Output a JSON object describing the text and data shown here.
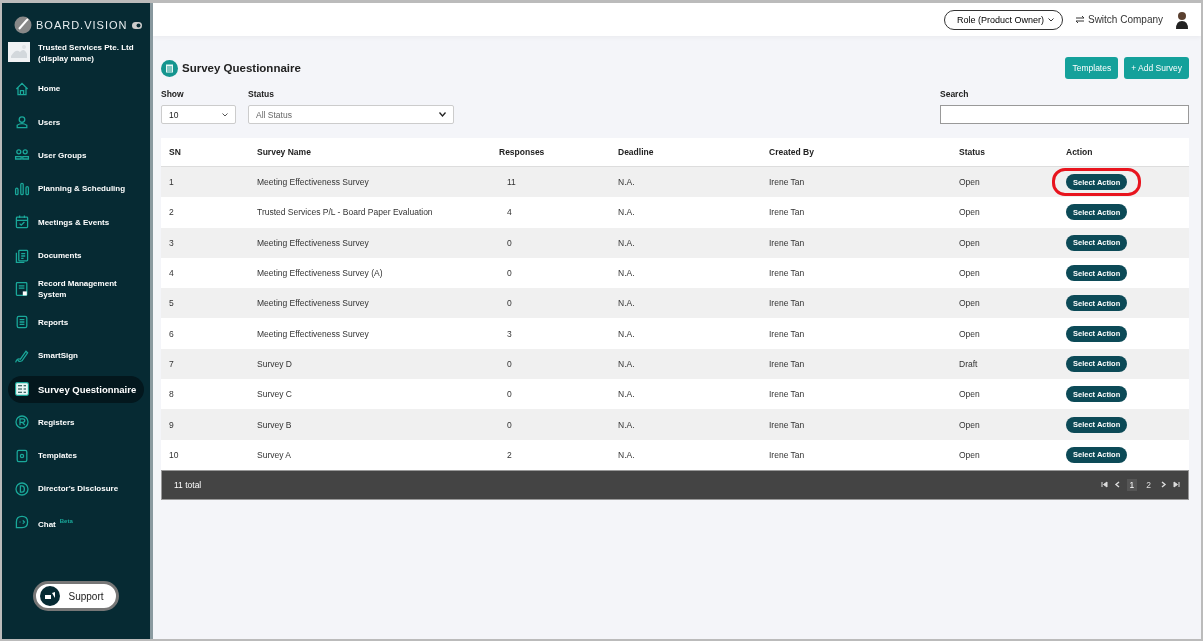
{
  "sidebar": {
    "brand": "BOARD.VISION",
    "company": "Trusted Services Pte. Ltd (display name)",
    "items": [
      {
        "label": "Home",
        "selected": false
      },
      {
        "label": "Users",
        "selected": false
      },
      {
        "label": "User Groups",
        "selected": false
      },
      {
        "label": "Planning & Scheduling",
        "selected": false
      },
      {
        "label": "Meetings & Events",
        "selected": false
      },
      {
        "label": "Documents",
        "selected": false
      },
      {
        "label": "Record Management System",
        "selected": false
      },
      {
        "label": "Reports",
        "selected": false
      },
      {
        "label": "SmartSign",
        "selected": false
      },
      {
        "label": "Survey Questionnaire",
        "selected": true
      },
      {
        "label": "Registers",
        "selected": false
      },
      {
        "label": "Templates",
        "selected": false
      },
      {
        "label": "Director's Disclosure",
        "selected": false
      },
      {
        "label": "Chat",
        "selected": false,
        "badge": "Beta"
      }
    ],
    "support": "Support"
  },
  "topbar": {
    "role": "Role (Product Owner)",
    "switch_company": "Switch Company"
  },
  "page": {
    "title": "Survey Questionnaire",
    "buttons": [
      "Templates",
      "+ Add Survey"
    ],
    "show": {
      "label": "Show",
      "value": "10"
    },
    "status": {
      "label": "Status",
      "value": "All Status"
    },
    "search": {
      "label": "Search"
    }
  },
  "table": {
    "columns": [
      "SN",
      "Survey Name",
      "Responses",
      "Deadline",
      "Created By",
      "Status",
      "Action"
    ],
    "rows": [
      {
        "cells": [
          "1",
          "Meeting Effectiveness Survey",
          "11",
          "N.A.",
          "Irene Tan",
          "Open"
        ],
        "action": "Select Action",
        "highlighted": true
      },
      {
        "cells": [
          "2",
          "Trusted Services P/L - Board Paper Evaluation",
          "4",
          "N.A.",
          "Irene Tan",
          "Open"
        ],
        "action": "Select Action",
        "highlighted": false
      },
      {
        "cells": [
          "3",
          "Meeting Effectiveness Survey",
          "0",
          "N.A.",
          "Irene Tan",
          "Open"
        ],
        "action": "Select Action",
        "highlighted": false
      },
      {
        "cells": [
          "4",
          "Meeting Effectiveness Survey (A)",
          "0",
          "N.A.",
          "Irene Tan",
          "Open"
        ],
        "action": "Select Action",
        "highlighted": false
      },
      {
        "cells": [
          "5",
          "Meeting Effectiveness Survey",
          "0",
          "N.A.",
          "Irene Tan",
          "Open"
        ],
        "action": "Select Action",
        "highlighted": false
      },
      {
        "cells": [
          "6",
          "Meeting Effectiveness Survey",
          "3",
          "N.A.",
          "Irene Tan",
          "Open"
        ],
        "action": "Select Action",
        "highlighted": false
      },
      {
        "cells": [
          "7",
          "Survey D",
          "0",
          "N.A.",
          "Irene Tan",
          "Draft"
        ],
        "action": "Select Action",
        "highlighted": false
      },
      {
        "cells": [
          "8",
          "Survey C",
          "0",
          "N.A.",
          "Irene Tan",
          "Open"
        ],
        "action": "Select Action",
        "highlighted": false
      },
      {
        "cells": [
          "9",
          "Survey B",
          "0",
          "N.A.",
          "Irene Tan",
          "Open"
        ],
        "action": "Select Action",
        "highlighted": false
      },
      {
        "cells": [
          "10",
          "Survey A",
          "2",
          "N.A.",
          "Irene Tan",
          "Open"
        ],
        "action": "Select Action",
        "highlighted": false
      }
    ],
    "total": "11 total",
    "pages": [
      {
        "label": "1",
        "selected": true
      },
      {
        "label": "2",
        "selected": false
      }
    ]
  }
}
